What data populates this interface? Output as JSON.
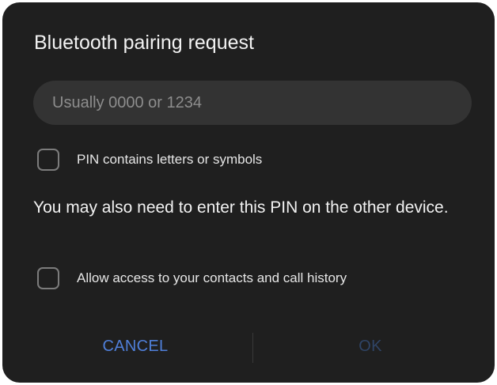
{
  "dialog": {
    "title": "Bluetooth pairing request",
    "pin_input": {
      "value": "",
      "placeholder": "Usually 0000 or 1234"
    },
    "pin_letters_checkbox": {
      "label": "PIN contains letters or symbols",
      "checked": false
    },
    "message": "You may also need to enter this PIN on the other device.",
    "contacts_checkbox": {
      "label": "Allow access to your contacts and call history",
      "checked": false
    },
    "buttons": {
      "cancel_label": "CANCEL",
      "ok_label": "OK"
    }
  },
  "colors": {
    "dialog_background": "#1f1f1f",
    "input_background": "#333333",
    "accent": "#4f7fd9",
    "accent_disabled": "#2f4466",
    "text_primary": "#f2f2f2"
  }
}
